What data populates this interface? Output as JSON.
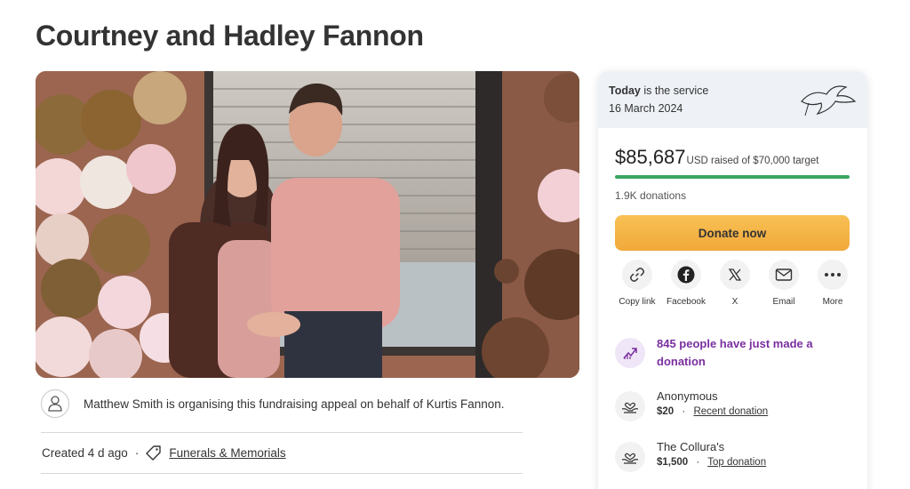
{
  "page": {
    "title": "Courtney and Hadley Fannon"
  },
  "organiser": {
    "text": "Matthew Smith is organising this fundraising appeal on behalf of Kurtis Fannon."
  },
  "meta": {
    "created": "Created 4 d ago",
    "separator": "·",
    "category": "Funerals & Memorials"
  },
  "sidebar": {
    "today_bold": "Today",
    "today_rest": " is the service",
    "date": "16 March 2024",
    "amount": "$85,687",
    "raised_suffix": "USD raised of $70,000 target",
    "progress_fraction": 1.0,
    "donations_count": "1.9K donations",
    "donate_label": "Donate now",
    "share": [
      {
        "icon": "link-icon",
        "label": "Copy link"
      },
      {
        "icon": "facebook-icon",
        "label": "Facebook"
      },
      {
        "icon": "x-icon",
        "label": "X"
      },
      {
        "icon": "mail-icon",
        "label": "Email"
      },
      {
        "icon": "more-icon",
        "label": "More"
      }
    ],
    "activity": "845 people have just made a donation",
    "donors": [
      {
        "name": "Anonymous",
        "amount": "$20",
        "separator": "·",
        "tag": "Recent donation"
      },
      {
        "name": "The Collura's",
        "amount": "$1,500",
        "separator": "·",
        "tag": "Top donation"
      }
    ]
  },
  "colors": {
    "accent_green": "#3aa562",
    "donate_orange": "#f4b244",
    "activity_purple": "#7a2fa0"
  }
}
